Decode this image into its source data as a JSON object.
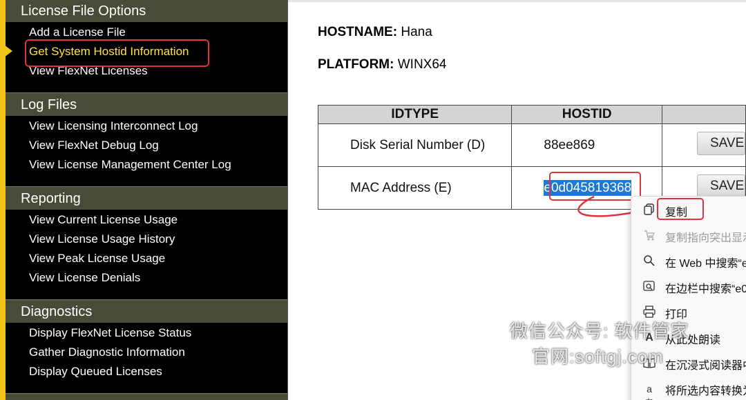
{
  "sidebar": {
    "sections": [
      {
        "title": "License File Options",
        "items": [
          "Add a License File",
          "Get System Hostid Information",
          "View FlexNet Licenses"
        ]
      },
      {
        "title": "Log Files",
        "items": [
          "View Licensing Interconnect Log",
          "View FlexNet Debug Log",
          "View License Management Center Log"
        ]
      },
      {
        "title": "Reporting",
        "items": [
          "View Current License Usage",
          "View License Usage History",
          "View Peak License Usage",
          "View License Denials"
        ]
      },
      {
        "title": "Diagnostics",
        "items": [
          "Display FlexNet License Status",
          "Gather Diagnostic Information",
          "Display Queued Licenses"
        ]
      }
    ],
    "active_item": "Get System Hostid Information",
    "accent_color": "#f0c419",
    "active_text_color": "#ffe23a"
  },
  "host": {
    "hostname_label": "HOSTNAME:",
    "hostname_value": "Hana",
    "platform_label": "PLATFORM:",
    "platform_value": "WINX64"
  },
  "table": {
    "headers": [
      "IDTYPE",
      "HOSTID",
      ""
    ],
    "rows": [
      {
        "idtype": "Disk Serial Number (D)",
        "hostid": "88ee869",
        "action": "SAVE"
      },
      {
        "idtype": "MAC Address (E)",
        "hostid": "e0d045819368",
        "action": "SAVE"
      }
    ]
  },
  "context_menu": {
    "items": [
      {
        "icon": "copy-icon",
        "label": "复制",
        "enabled": true
      },
      {
        "icon": "copy-link-highlight-icon",
        "label": "复制指向突出显示",
        "enabled": false
      },
      {
        "icon": "search-icon",
        "label": "在 Web 中搜索“e",
        "enabled": true
      },
      {
        "icon": "sidebar-search-icon",
        "label": "在边栏中搜索“e0",
        "enabled": true
      },
      {
        "icon": "print-icon",
        "label": "打印",
        "enabled": true
      },
      {
        "icon": "read-aloud-icon",
        "label": "从此处朗读",
        "enabled": true
      },
      {
        "icon": "immersive-reader-icon",
        "label": "在沉浸式阅读器中",
        "enabled": true
      },
      {
        "icon": "translate-icon",
        "label": "将所选内容转换为",
        "enabled": true
      }
    ]
  },
  "watermark": {
    "line1": "微信公众号: 软件管家",
    "line2": "官网:softgj.com"
  },
  "colors": {
    "highlight_red": "#e0333c",
    "selection_blue": "#1e78d6"
  }
}
